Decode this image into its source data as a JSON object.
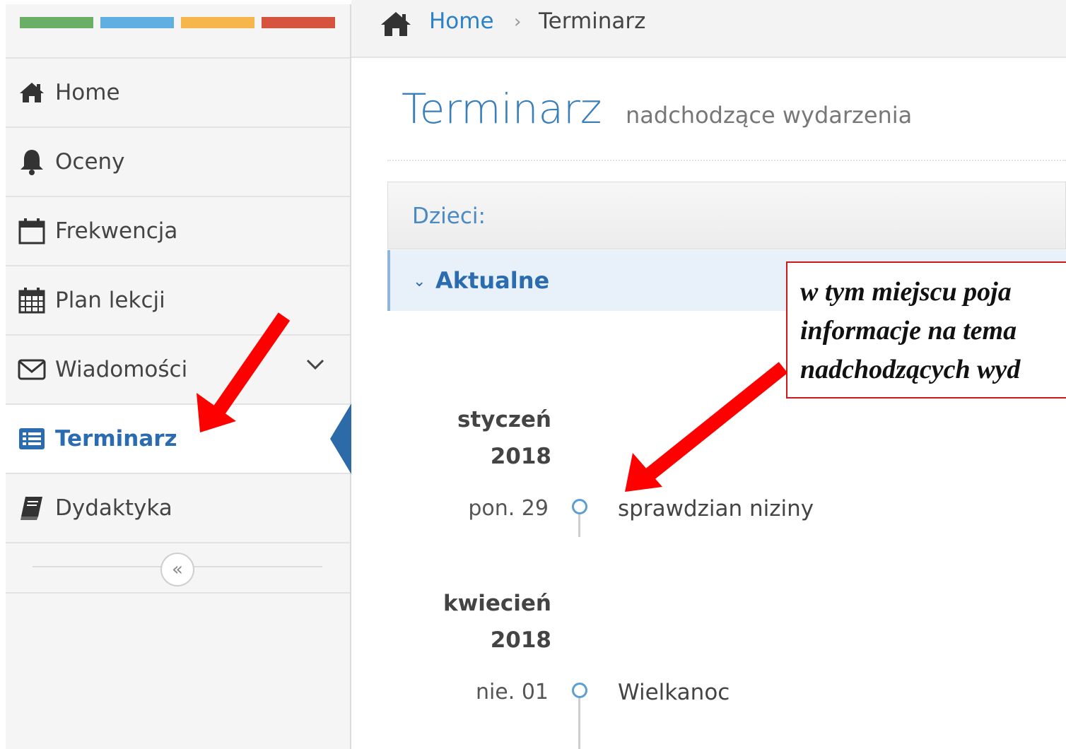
{
  "colors": {
    "accent": "#2b6cb0",
    "link": "#2b82c9",
    "brand_bar": [
      "#6aaf65",
      "#5fb0e0",
      "#f7b64b",
      "#d6533e"
    ],
    "annotation_border": "#d01818",
    "arrow": "#ff0000"
  },
  "breadcrumb": {
    "home_icon": "home-icon",
    "home": "Home",
    "separator": "›",
    "current": "Terminarz"
  },
  "sidebar": {
    "items": [
      {
        "label": "Home",
        "icon": "home-icon"
      },
      {
        "label": "Oceny",
        "icon": "bell-icon"
      },
      {
        "label": "Frekwencja",
        "icon": "calendar-icon"
      },
      {
        "label": "Plan lekcji",
        "icon": "calendar-grid-icon"
      },
      {
        "label": "Wiadomości",
        "icon": "envelope-icon",
        "has_submenu": true
      },
      {
        "label": "Terminarz",
        "icon": "list-icon",
        "active": true
      },
      {
        "label": "Dydaktyka",
        "icon": "book-icon"
      }
    ],
    "collapse_label": "«"
  },
  "page": {
    "title": "Terminarz",
    "subtitle": "nadchodzące wydarzenia"
  },
  "panel": {
    "header": "Dzieci:",
    "section": "Aktualne",
    "section_chevron": "⌄"
  },
  "timeline": {
    "groups": [
      {
        "month": "styczeń",
        "year": "2018",
        "events": [
          {
            "date": "pon. 29",
            "title": "sprawdzian niziny"
          }
        ]
      },
      {
        "month": "kwiecień",
        "year": "2018",
        "events": [
          {
            "date": "nie. 01",
            "title": "Wielkanoc"
          }
        ]
      }
    ]
  },
  "annotation": {
    "line1": "w tym miejscu poja",
    "line2": "informacje na tema",
    "line3": "nadchodzących wyd"
  }
}
